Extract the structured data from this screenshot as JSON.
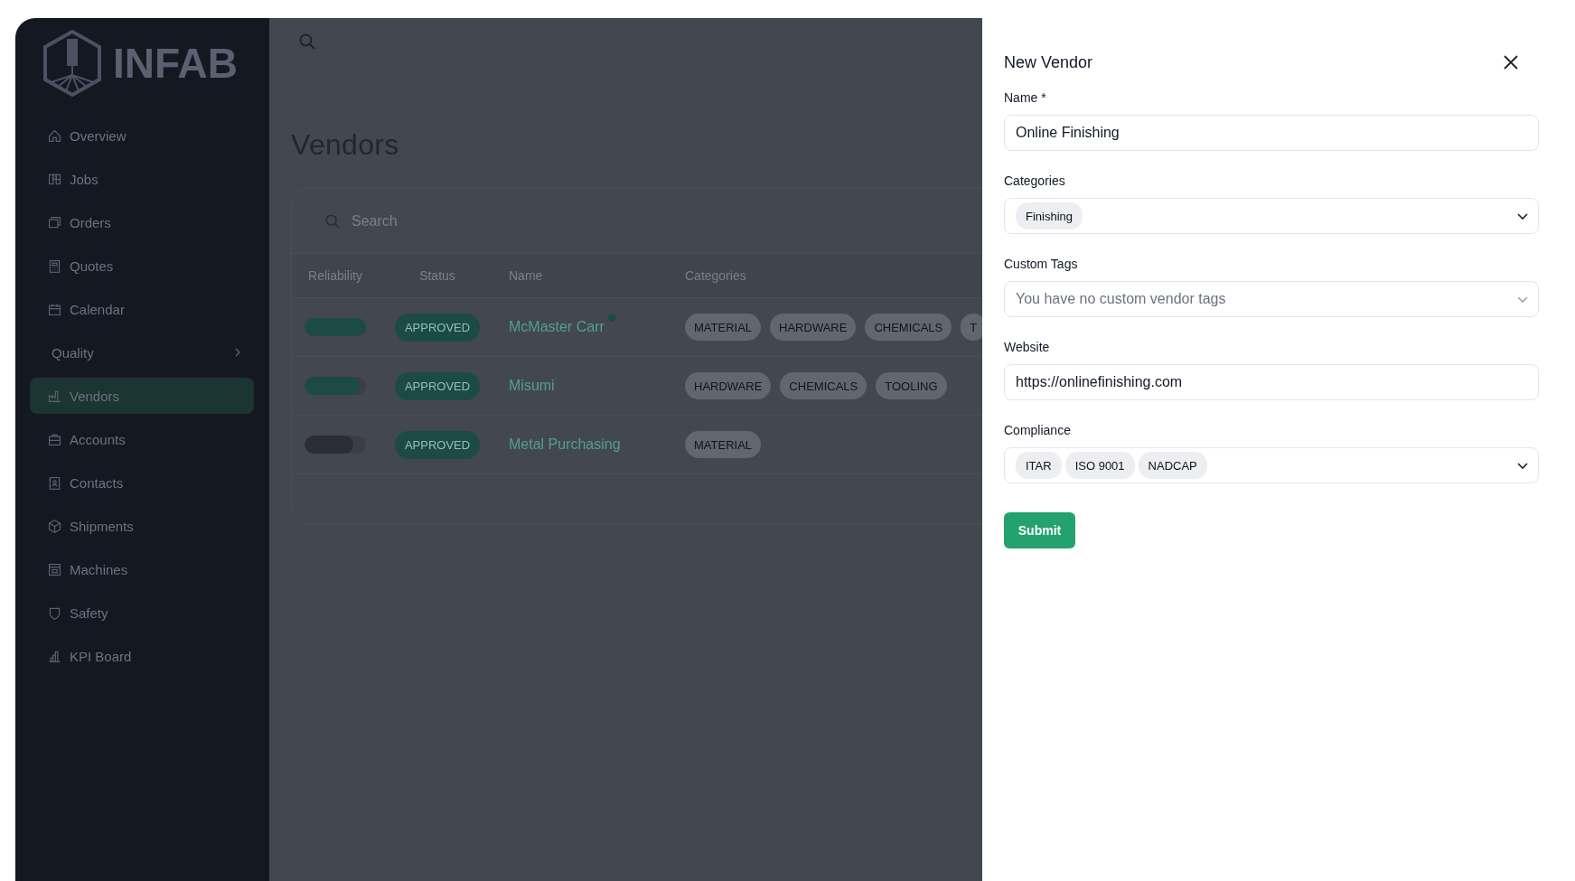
{
  "sidebar": {
    "logo_text": "INFAB",
    "items": [
      {
        "label": "Overview",
        "kind": "link",
        "selected": false
      },
      {
        "label": "Jobs",
        "kind": "link",
        "selected": false
      },
      {
        "label": "Orders",
        "kind": "link",
        "selected": false
      },
      {
        "label": "Quotes",
        "kind": "link",
        "selected": false
      },
      {
        "label": "Calendar",
        "kind": "link",
        "selected": false
      },
      {
        "label": "Quality",
        "kind": "group",
        "expanded": false,
        "selected": false
      },
      {
        "label": "Vendors",
        "kind": "link",
        "selected": true
      },
      {
        "label": "Accounts",
        "kind": "link",
        "selected": false
      },
      {
        "label": "Contacts",
        "kind": "link",
        "selected": false
      },
      {
        "label": "Shipments",
        "kind": "link",
        "selected": false
      },
      {
        "label": "Machines",
        "kind": "link",
        "selected": false
      },
      {
        "label": "Safety",
        "kind": "link",
        "selected": false
      },
      {
        "label": "KPI Board",
        "kind": "link",
        "selected": false
      }
    ]
  },
  "main": {
    "title": "Vendors",
    "search": {
      "placeholder": "Search"
    },
    "table": {
      "columns": [
        "Reliability",
        "Status",
        "Name",
        "Categories"
      ],
      "rows": [
        {
          "reliability": {
            "level": 1,
            "color": "#1c4b46"
          },
          "status": "APPROVED",
          "name": "McMaster Carr",
          "flagged": true,
          "categories": [
            "MATERIAL",
            "HARDWARE",
            "CHEMICALS",
            "T"
          ]
        },
        {
          "reliability": {
            "level": 0.9,
            "color": "#1c4b46"
          },
          "status": "APPROVED",
          "name": "Misumi",
          "flagged": false,
          "categories": [
            "HARDWARE",
            "CHEMICALS",
            "TOOLING"
          ]
        },
        {
          "reliability": {
            "level": 0.8,
            "color": "#2a2d33"
          },
          "status": "APPROVED",
          "name": "Metal Purchasing",
          "flagged": false,
          "categories": [
            "MATERIAL"
          ]
        }
      ]
    }
  },
  "panel": {
    "title": "New Vendor",
    "fields": [
      {
        "kind": "text",
        "label": "Name *",
        "value": "Online Finishing"
      },
      {
        "kind": "select",
        "label": "Categories",
        "chips": [
          "Finishing"
        ],
        "disabled": false
      },
      {
        "kind": "select",
        "label": "Custom Tags",
        "placeholder": "You have no custom vendor tags",
        "disabled": true
      },
      {
        "kind": "text",
        "label": "Website",
        "value": "https://onlinefinishing.com"
      },
      {
        "kind": "select",
        "label": "Compliance",
        "chips": [
          "ITAR",
          "ISO 9001",
          "NADCAP"
        ],
        "disabled": false
      }
    ],
    "submit_label": "Submit"
  }
}
